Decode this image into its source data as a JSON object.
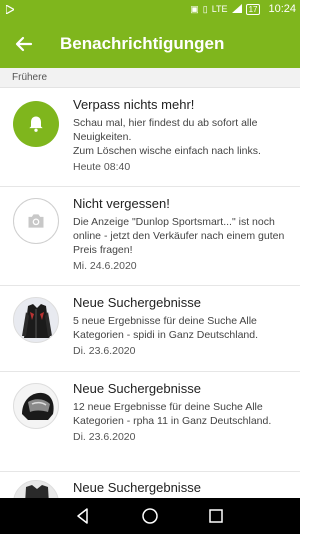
{
  "statusbar": {
    "battery": "17",
    "time": "10:24",
    "network": "LTE"
  },
  "appbar": {
    "title": "Benachrichtigungen",
    "back_icon": "arrow-left-icon"
  },
  "section": {
    "label": "Frühere"
  },
  "notifications": [
    {
      "title": "Verpass nichts mehr!",
      "body": "Schau mal, hier findest du ab sofort alle Neuigkeiten.\nZum Löschen wische einfach nach links.",
      "date": "Heute 08:40",
      "icon": "bell-icon"
    },
    {
      "title": "Nicht vergessen!",
      "body": "Die Anzeige \"Dunlop Sportsmart...\" ist noch online - jetzt den Verkäufer nach einem guten Preis fragen!",
      "date": "Mi. 24.6.2020",
      "icon": "camera-icon"
    },
    {
      "title": "Neue Suchergebnisse",
      "body": "5 neue Ergebnisse für deine Suche Alle Kategorien - spidi in Ganz Deutschland.",
      "date": "Di. 23.6.2020",
      "icon": "jacket-thumbnail"
    },
    {
      "title": "Neue Suchergebnisse",
      "body": "12 neue Ergebnisse für deine Suche Alle Kategorien - rpha 11 in Ganz Deutschland.",
      "date": "Di. 23.6.2020",
      "icon": "helmet-thumbnail"
    },
    {
      "title": "Neue Suchergebnisse",
      "body": "",
      "date": "",
      "icon": "jacket-thumbnail"
    }
  ],
  "colors": {
    "brand": "#7fb61d"
  }
}
